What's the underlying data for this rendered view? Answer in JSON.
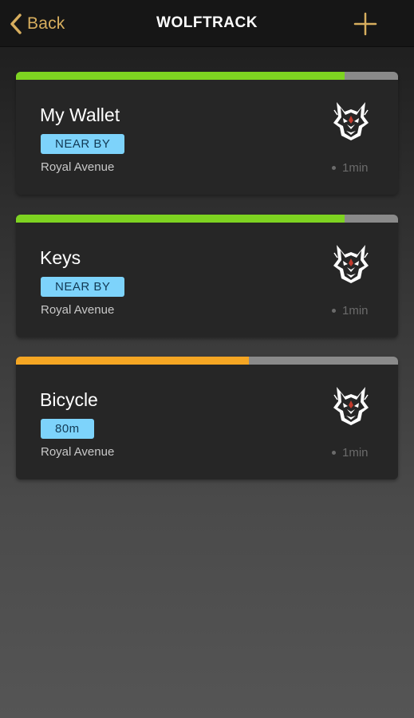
{
  "header": {
    "back_label": "Back",
    "title": "WOLFTRACK",
    "accent_color": "#d7ae5e",
    "back_icon": "chevron-left-icon",
    "add_icon": "plus-icon"
  },
  "devices": [
    {
      "name": "My Wallet",
      "status": "NEAR BY",
      "location": "Royal Avenue",
      "time": "1min",
      "signal_fraction": 0.86,
      "signal_color": "#7ed321"
    },
    {
      "name": "Keys",
      "status": "NEAR BY",
      "location": "Royal Avenue",
      "time": "1min",
      "signal_fraction": 0.86,
      "signal_color": "#7ed321"
    },
    {
      "name": "Bicycle",
      "status": "80m",
      "location": "Royal Avenue",
      "time": "1min",
      "signal_fraction": 0.61,
      "signal_color": "#f5a623"
    }
  ],
  "colors": {
    "badge_bg": "#7dd3fb",
    "card_bg": "#262626",
    "signal_track": "#8a8a8a"
  },
  "card_icon": "wolf-logo-icon"
}
